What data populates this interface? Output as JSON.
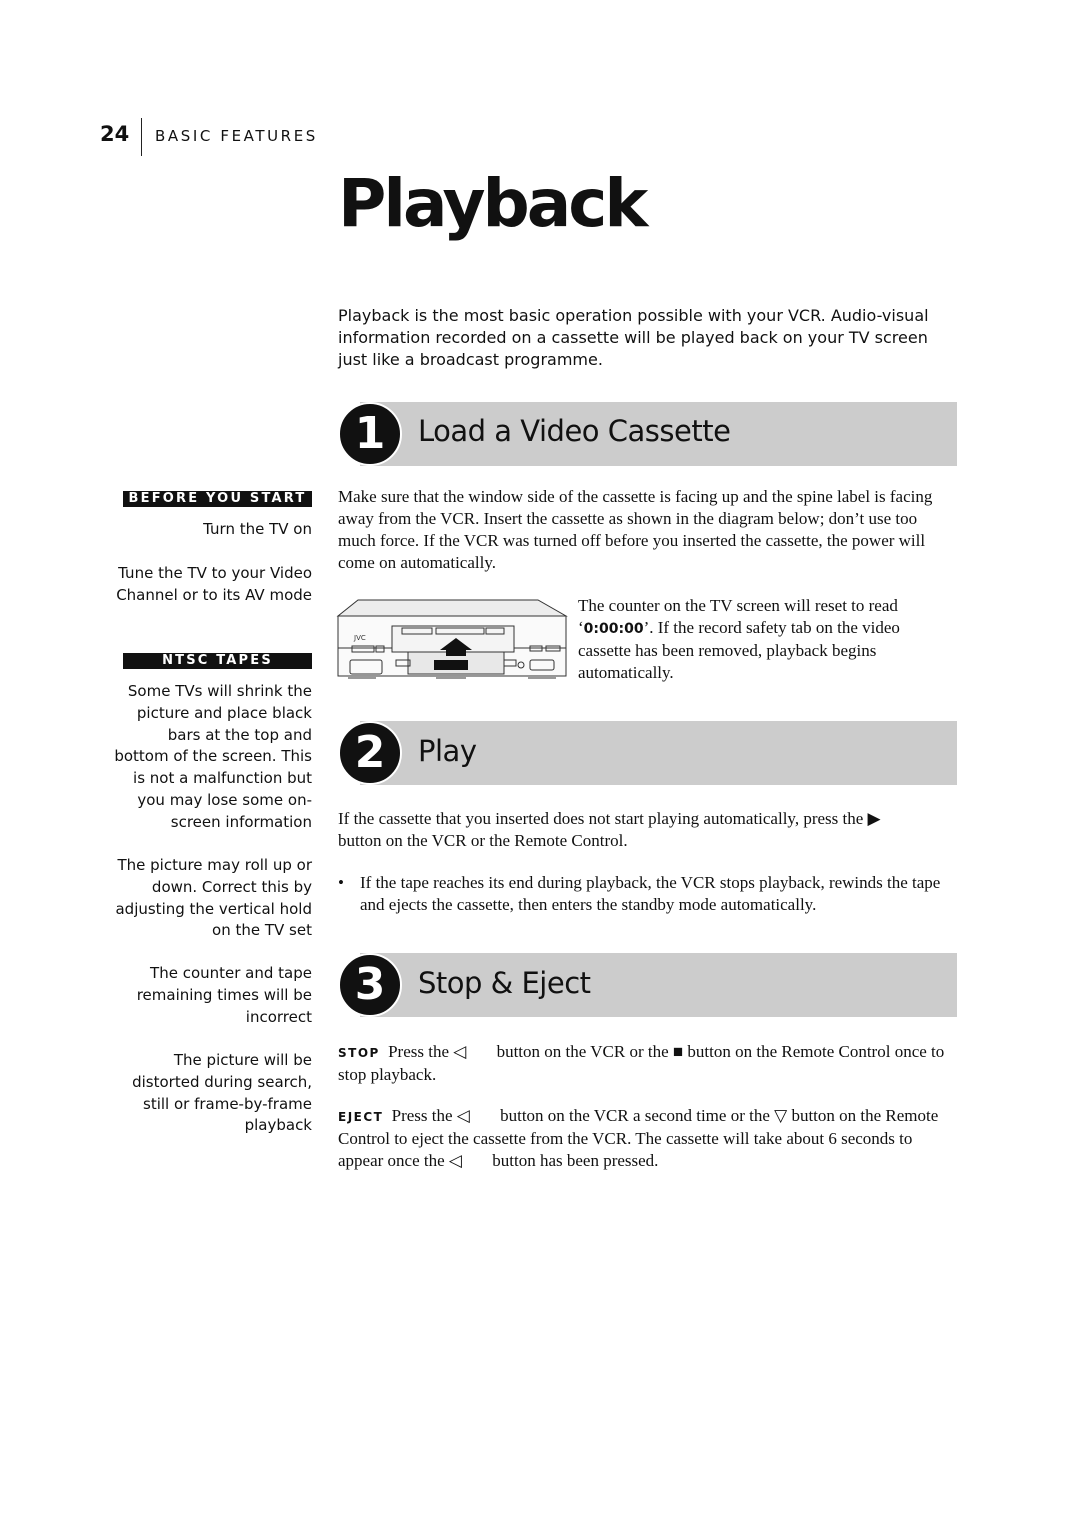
{
  "header": {
    "page_number": "24",
    "section": "BASIC FEATURES"
  },
  "title": "Playback",
  "intro": "Playback is the most basic operation possible with your VCR. Audio-visual information recorded on a cassette will be played back on your TV screen just like a broadcast programme.",
  "sidebar": {
    "before_you_start": {
      "label": "BEFORE YOU START",
      "notes": [
        "Turn the TV on",
        "Tune the TV to your Video Channel or to its AV mode"
      ]
    },
    "ntsc_tapes": {
      "label": "NTSC TAPES",
      "notes": [
        "Some TVs will shrink the picture and place black bars at the top and bottom of the screen. This is not a malfunction but you may lose some on-screen information",
        "The picture may roll up or down. Correct this by adjusting the vertical hold on the TV set",
        "The counter and tape remaining times will be incorrect",
        "The picture will be distorted during search, still or frame-by-frame playback"
      ]
    }
  },
  "steps": [
    {
      "number": "1",
      "title": "Load a Video Cassette",
      "body": "Make sure that the window side of the cassette is facing up and the spine label is facing away from the VCR. Insert the cassette as shown in the diagram below; don’t use too much force. If the VCR was turned off before you inserted the cassette, the power will come on automatically.",
      "figure": {
        "icon": "vcr-cassette-insert-illustration",
        "caption_before": "The counter on the TV screen will reset to read ‘",
        "counter": "0:00:00",
        "caption_after": "’. If the record safety tab on the video cassette has been removed, playback begins automatically."
      }
    },
    {
      "number": "2",
      "title": "Play",
      "body_before": "If the cassette that you inserted does not start playing automatically, press the",
      "body_icon": "play-icon",
      "body_after": "button on the VCR or the Remote Control.",
      "bullet": "If the tape reaches its end during playback, the VCR stops playback, rewinds the tape and ejects the cassette, then enters the standby mode automatically."
    },
    {
      "number": "3",
      "title": "Stop & Eject",
      "stop": {
        "label": "STOP",
        "text1": "Press the",
        "icon1": "stop-eject-button-icon",
        "text2": "button on the VCR or the",
        "icon2": "stop-square-icon",
        "text3": "button on the Remote Control once to stop playback."
      },
      "eject": {
        "label": "EJECT",
        "text1": "Press the",
        "icon1": "stop-eject-button-icon",
        "text2": "button on the VCR a second time or the",
        "icon2": "eject-triangle-icon",
        "text3": "button on the Remote Control to eject the cassette from the VCR. The cassette will take about 6 seconds to appear once the",
        "icon3": "stop-eject-button-icon",
        "text4": "button has been pressed."
      }
    }
  ]
}
